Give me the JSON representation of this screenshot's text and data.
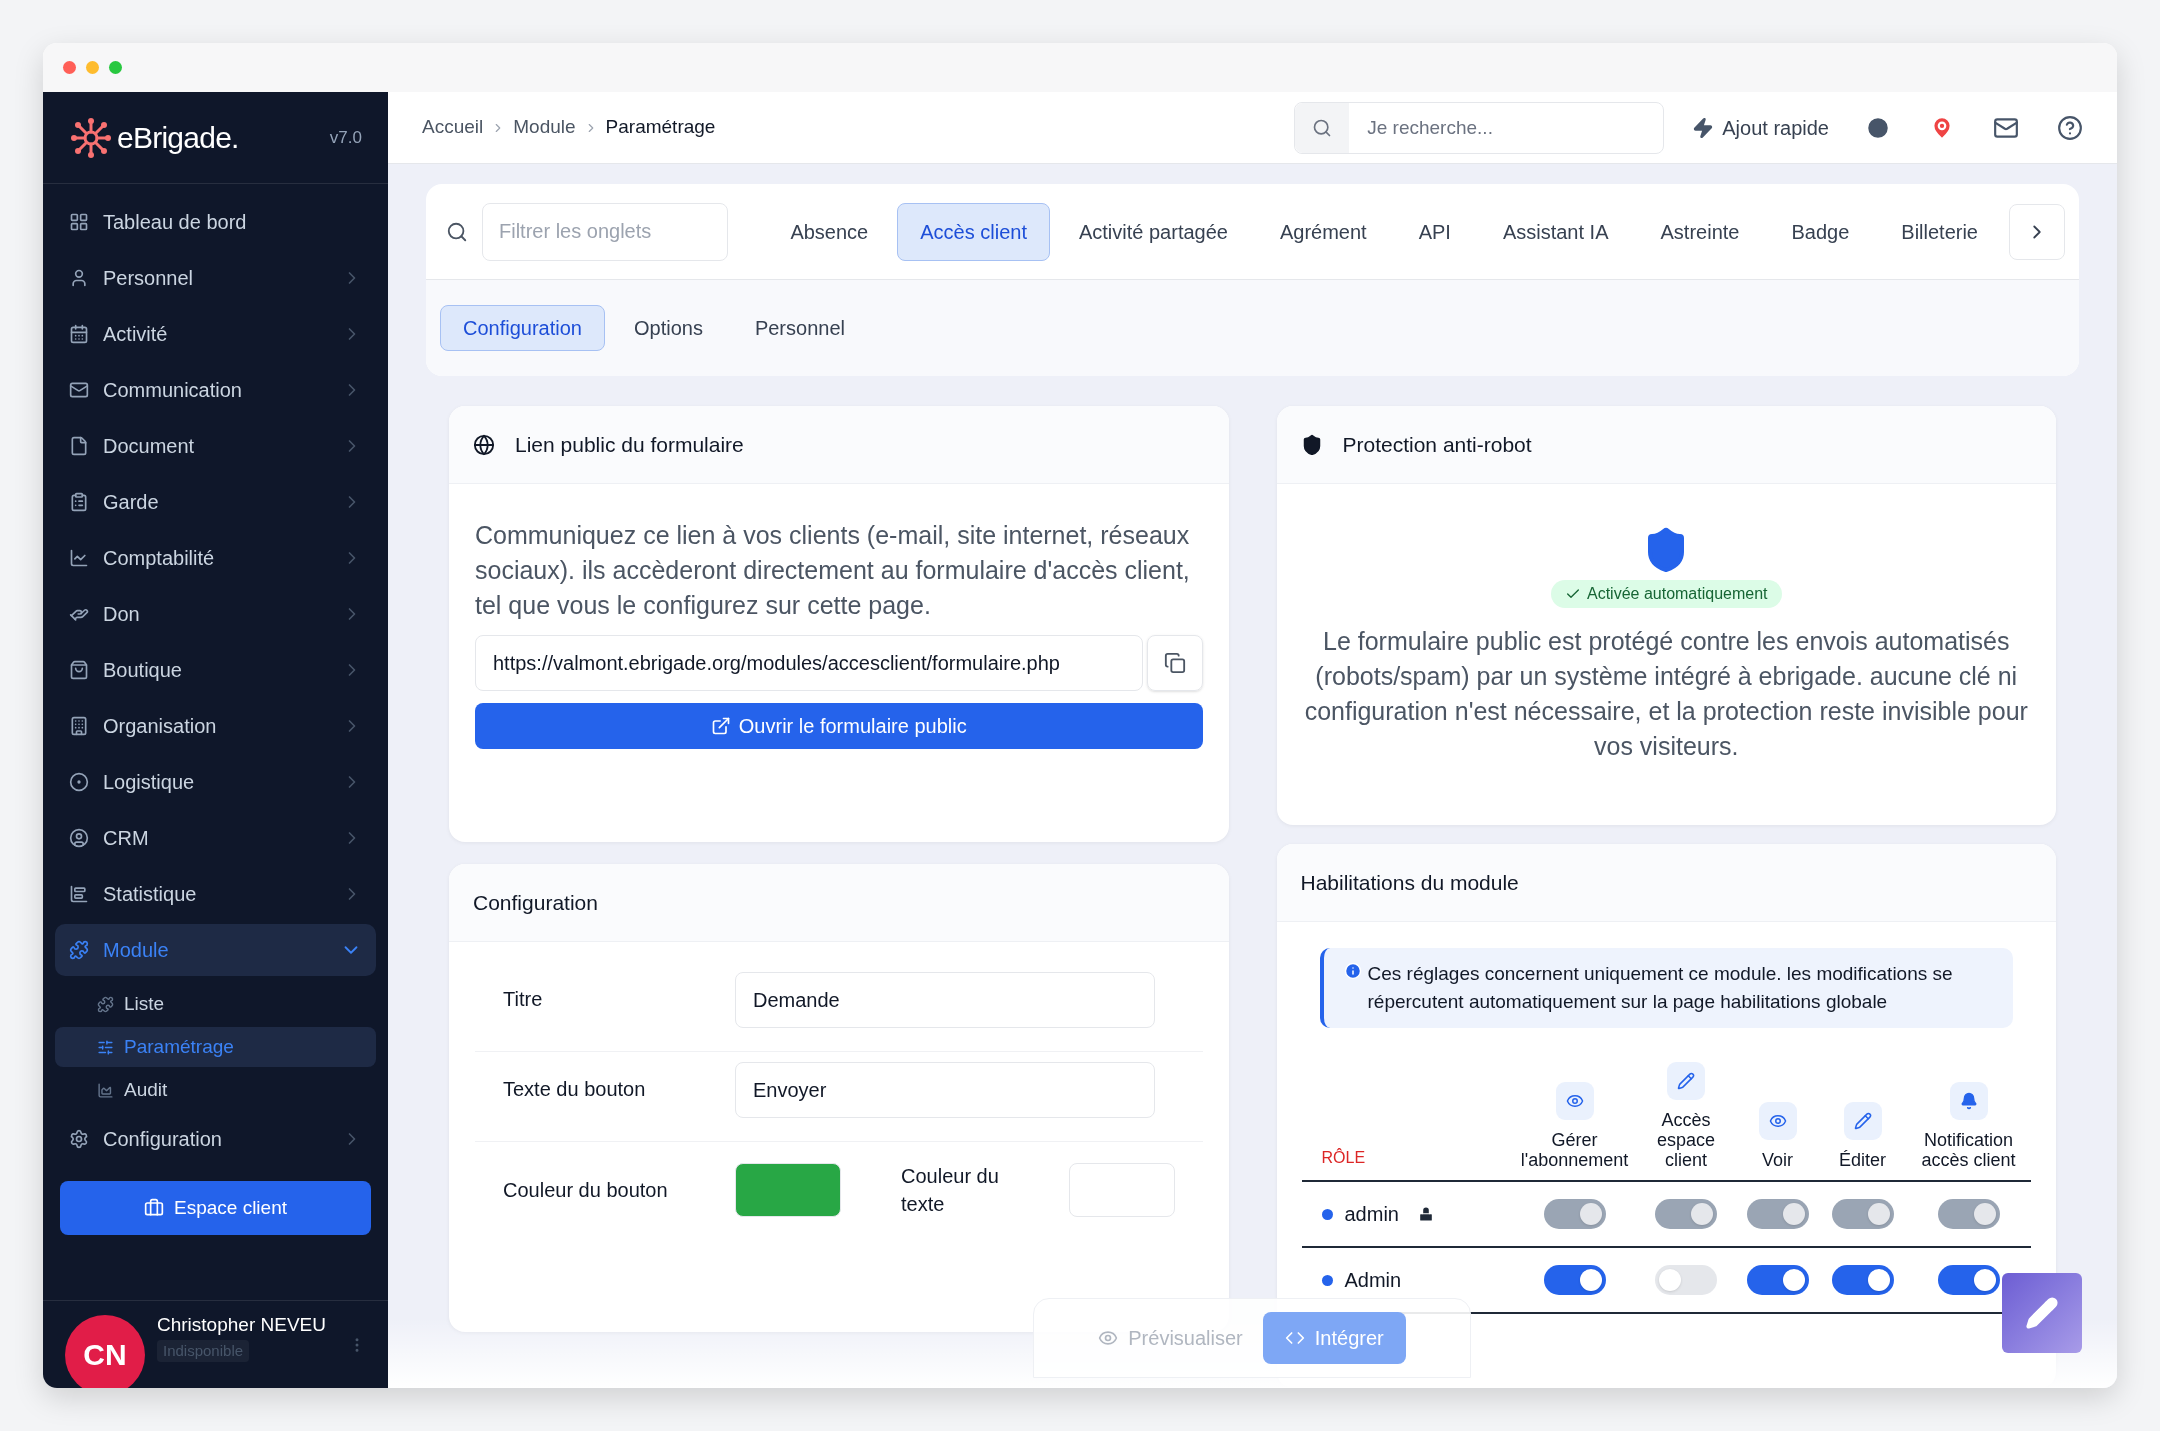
{
  "sidebar": {
    "brand": "eBrigade.",
    "version": "v7.0",
    "items": [
      {
        "label": "Tableau de bord",
        "chevron": false,
        "expanded": false,
        "selected": false
      },
      {
        "label": "Personnel",
        "chevron": true,
        "expanded": false,
        "selected": false
      },
      {
        "label": "Activité",
        "chevron": true,
        "expanded": false,
        "selected": false
      },
      {
        "label": "Communication",
        "chevron": true,
        "expanded": false,
        "selected": false
      },
      {
        "label": "Document",
        "chevron": true,
        "expanded": false,
        "selected": false
      },
      {
        "label": "Garde",
        "chevron": true,
        "expanded": false,
        "selected": false
      },
      {
        "label": "Comptabilité",
        "chevron": true,
        "expanded": false,
        "selected": false
      },
      {
        "label": "Don",
        "chevron": true,
        "expanded": false,
        "selected": false
      },
      {
        "label": "Boutique",
        "chevron": true,
        "expanded": false,
        "selected": false
      },
      {
        "label": "Organisation",
        "chevron": true,
        "expanded": false,
        "selected": false
      },
      {
        "label": "Logistique",
        "chevron": true,
        "expanded": false,
        "selected": false
      },
      {
        "label": "CRM",
        "chevron": true,
        "expanded": false,
        "selected": false
      },
      {
        "label": "Statistique",
        "chevron": true,
        "expanded": false,
        "selected": false
      },
      {
        "label": "Module",
        "chevron": true,
        "expanded": true,
        "selected": true,
        "children": [
          {
            "label": "Liste",
            "selected": false
          },
          {
            "label": "Paramétrage",
            "selected": true
          },
          {
            "label": "Audit",
            "selected": false
          }
        ]
      },
      {
        "label": "Configuration",
        "chevron": true,
        "expanded": false,
        "selected": false
      }
    ],
    "action_button": "Espace client",
    "user": {
      "initials": "CN",
      "name": "Christopher NEVEU",
      "status": "Indisponible"
    }
  },
  "breadcrumb": [
    "Accueil",
    "Module",
    "Paramétrage"
  ],
  "search": {
    "placeholder": "Je recherche..."
  },
  "quick_add": "Ajout rapide",
  "tab_filter": {
    "placeholder": "Filtrer les onglets"
  },
  "tabs": [
    {
      "label": "Absence",
      "selected": false
    },
    {
      "label": "Accès client",
      "selected": true
    },
    {
      "label": "Activité partagée",
      "selected": false
    },
    {
      "label": "Agrément",
      "selected": false
    },
    {
      "label": "API",
      "selected": false
    },
    {
      "label": "Assistant IA",
      "selected": false
    },
    {
      "label": "Astreinte",
      "selected": false
    },
    {
      "label": "Badge",
      "selected": false
    },
    {
      "label": "Billeterie",
      "selected": false
    }
  ],
  "subtabs": [
    {
      "label": "Configuration",
      "selected": true
    },
    {
      "label": "Options",
      "selected": false
    },
    {
      "label": "Personnel",
      "selected": false
    }
  ],
  "public_link": {
    "title": "Lien public du formulaire",
    "description": "Communiquez ce lien à vos clients (e-mail, site internet, réseaux sociaux). ils accèderont directement au formulaire d'accès client, tel que vous le configurez sur cette page.",
    "url": "https://valmont.ebrigade.org/modules/accesclient/formulaire.php",
    "open_button": "Ouvrir le formulaire public"
  },
  "configuration": {
    "title": "Configuration",
    "fields": [
      {
        "label": "Titre",
        "value": "Demande"
      },
      {
        "label": "Texte du bouton",
        "value": "Envoyer"
      }
    ],
    "colors": [
      {
        "label": "Couleur du bouton",
        "color": "#28a745"
      },
      {
        "label": "Couleur du texte",
        "color": "#ffffff"
      }
    ]
  },
  "protection": {
    "title": "Protection anti-robot",
    "badge": "Activée automatiquement",
    "description": "Le formulaire public est protégé contre les envois automatisés (robots/spam) par un système intégré à ebrigade. aucune clé ni configuration n'est nécessaire, et la protection reste invisible pour vos visiteurs."
  },
  "habilitations": {
    "title": "Habilitations du module",
    "info": "Ces réglages concernent uniquement ce module. les modifications se répercutent automatiquement sur la page habilitations globale",
    "role_header": "RÔLE",
    "columns": [
      "Gérer l'abonnement",
      "Accès espace client",
      "Voir",
      "Éditer",
      "Notification accès client"
    ],
    "rows": [
      {
        "name": "admin",
        "color": "#2563eb",
        "locked": true,
        "toggles": [
          {
            "on": true,
            "disabled": true
          },
          {
            "on": true,
            "disabled": true
          },
          {
            "on": true,
            "disabled": true
          },
          {
            "on": true,
            "disabled": true
          },
          {
            "on": true,
            "disabled": true
          }
        ]
      },
      {
        "name": "Admin",
        "color": "#2563eb",
        "locked": false,
        "toggles": [
          {
            "on": true,
            "disabled": false
          },
          {
            "on": false,
            "disabled": false
          },
          {
            "on": true,
            "disabled": false
          },
          {
            "on": true,
            "disabled": false
          },
          {
            "on": true,
            "disabled": false
          }
        ]
      }
    ]
  },
  "footer_actions": {
    "preview": "Prévisualiser",
    "embed": "Intégrer"
  }
}
